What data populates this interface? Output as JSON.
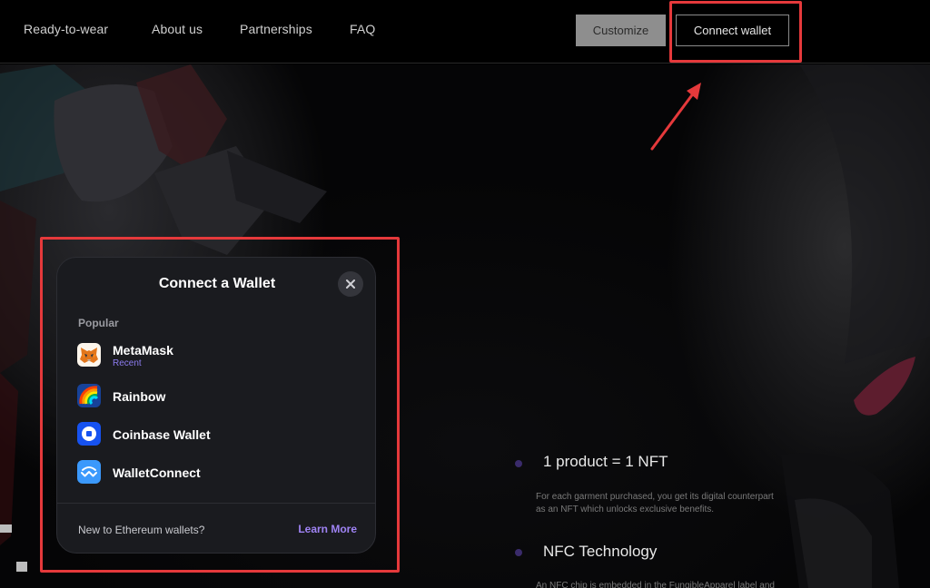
{
  "nav": {
    "links": [
      "Ready-to-wear",
      "About us",
      "Partnerships",
      "FAQ"
    ],
    "customize_label": "Customize",
    "connect_label": "Connect wallet"
  },
  "features": [
    {
      "title": "1 product = 1 NFT",
      "desc_line1": "For each garment purchased, you get its digital counterpart",
      "desc_line2": "as an NFT which unlocks exclusive benefits."
    },
    {
      "title": "NFC Technology",
      "desc_line1": "An NFC chip is embedded in the FungibleApparel label and",
      "desc_line2": ""
    }
  ],
  "modal": {
    "title": "Connect a Wallet",
    "close_icon": "close-icon",
    "section_label": "Popular",
    "wallets": [
      {
        "name": "MetaMask",
        "subtitle": "Recent",
        "icon": "metamask-fox-icon"
      },
      {
        "name": "Rainbow",
        "subtitle": "",
        "icon": "rainbow-icon"
      },
      {
        "name": "Coinbase Wallet",
        "subtitle": "",
        "icon": "coinbase-icon"
      },
      {
        "name": "WalletConnect",
        "subtitle": "",
        "icon": "walletconnect-icon"
      }
    ],
    "footer_text": "New to Ethereum wallets?",
    "footer_link": "Learn More"
  },
  "colors": {
    "annotation": "#e5393b",
    "accent_purple": "#9f83f4",
    "modal_bg": "#1a1b1f"
  }
}
